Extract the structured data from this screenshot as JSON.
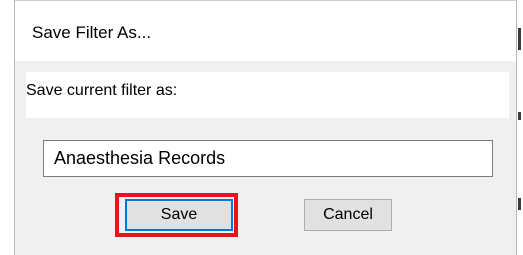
{
  "dialog": {
    "title": "Save Filter As...",
    "prompt": "Save current filter as:",
    "filter_name_value": "Anaesthesia Records",
    "filter_name_placeholder": "",
    "save_label": "Save",
    "cancel_label": "Cancel"
  },
  "colors": {
    "dialog_background": "#f0f0f0",
    "focus_border": "#0078d7",
    "highlight_annotation": "#e8141d"
  }
}
